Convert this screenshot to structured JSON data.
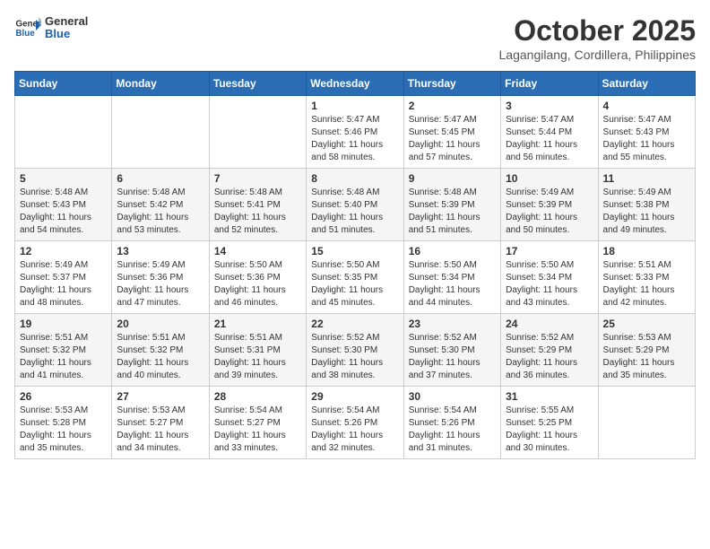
{
  "header": {
    "logo_line1": "General",
    "logo_line2": "Blue",
    "month_year": "October 2025",
    "location": "Lagangilang, Cordillera, Philippines"
  },
  "days_of_week": [
    "Sunday",
    "Monday",
    "Tuesday",
    "Wednesday",
    "Thursday",
    "Friday",
    "Saturday"
  ],
  "weeks": [
    [
      {
        "day": "",
        "content": ""
      },
      {
        "day": "",
        "content": ""
      },
      {
        "day": "",
        "content": ""
      },
      {
        "day": "1",
        "content": "Sunrise: 5:47 AM\nSunset: 5:46 PM\nDaylight: 11 hours and 58 minutes."
      },
      {
        "day": "2",
        "content": "Sunrise: 5:47 AM\nSunset: 5:45 PM\nDaylight: 11 hours and 57 minutes."
      },
      {
        "day": "3",
        "content": "Sunrise: 5:47 AM\nSunset: 5:44 PM\nDaylight: 11 hours and 56 minutes."
      },
      {
        "day": "4",
        "content": "Sunrise: 5:47 AM\nSunset: 5:43 PM\nDaylight: 11 hours and 55 minutes."
      }
    ],
    [
      {
        "day": "5",
        "content": "Sunrise: 5:48 AM\nSunset: 5:43 PM\nDaylight: 11 hours and 54 minutes."
      },
      {
        "day": "6",
        "content": "Sunrise: 5:48 AM\nSunset: 5:42 PM\nDaylight: 11 hours and 53 minutes."
      },
      {
        "day": "7",
        "content": "Sunrise: 5:48 AM\nSunset: 5:41 PM\nDaylight: 11 hours and 52 minutes."
      },
      {
        "day": "8",
        "content": "Sunrise: 5:48 AM\nSunset: 5:40 PM\nDaylight: 11 hours and 51 minutes."
      },
      {
        "day": "9",
        "content": "Sunrise: 5:48 AM\nSunset: 5:39 PM\nDaylight: 11 hours and 51 minutes."
      },
      {
        "day": "10",
        "content": "Sunrise: 5:49 AM\nSunset: 5:39 PM\nDaylight: 11 hours and 50 minutes."
      },
      {
        "day": "11",
        "content": "Sunrise: 5:49 AM\nSunset: 5:38 PM\nDaylight: 11 hours and 49 minutes."
      }
    ],
    [
      {
        "day": "12",
        "content": "Sunrise: 5:49 AM\nSunset: 5:37 PM\nDaylight: 11 hours and 48 minutes."
      },
      {
        "day": "13",
        "content": "Sunrise: 5:49 AM\nSunset: 5:36 PM\nDaylight: 11 hours and 47 minutes."
      },
      {
        "day": "14",
        "content": "Sunrise: 5:50 AM\nSunset: 5:36 PM\nDaylight: 11 hours and 46 minutes."
      },
      {
        "day": "15",
        "content": "Sunrise: 5:50 AM\nSunset: 5:35 PM\nDaylight: 11 hours and 45 minutes."
      },
      {
        "day": "16",
        "content": "Sunrise: 5:50 AM\nSunset: 5:34 PM\nDaylight: 11 hours and 44 minutes."
      },
      {
        "day": "17",
        "content": "Sunrise: 5:50 AM\nSunset: 5:34 PM\nDaylight: 11 hours and 43 minutes."
      },
      {
        "day": "18",
        "content": "Sunrise: 5:51 AM\nSunset: 5:33 PM\nDaylight: 11 hours and 42 minutes."
      }
    ],
    [
      {
        "day": "19",
        "content": "Sunrise: 5:51 AM\nSunset: 5:32 PM\nDaylight: 11 hours and 41 minutes."
      },
      {
        "day": "20",
        "content": "Sunrise: 5:51 AM\nSunset: 5:32 PM\nDaylight: 11 hours and 40 minutes."
      },
      {
        "day": "21",
        "content": "Sunrise: 5:51 AM\nSunset: 5:31 PM\nDaylight: 11 hours and 39 minutes."
      },
      {
        "day": "22",
        "content": "Sunrise: 5:52 AM\nSunset: 5:30 PM\nDaylight: 11 hours and 38 minutes."
      },
      {
        "day": "23",
        "content": "Sunrise: 5:52 AM\nSunset: 5:30 PM\nDaylight: 11 hours and 37 minutes."
      },
      {
        "day": "24",
        "content": "Sunrise: 5:52 AM\nSunset: 5:29 PM\nDaylight: 11 hours and 36 minutes."
      },
      {
        "day": "25",
        "content": "Sunrise: 5:53 AM\nSunset: 5:29 PM\nDaylight: 11 hours and 35 minutes."
      }
    ],
    [
      {
        "day": "26",
        "content": "Sunrise: 5:53 AM\nSunset: 5:28 PM\nDaylight: 11 hours and 35 minutes."
      },
      {
        "day": "27",
        "content": "Sunrise: 5:53 AM\nSunset: 5:27 PM\nDaylight: 11 hours and 34 minutes."
      },
      {
        "day": "28",
        "content": "Sunrise: 5:54 AM\nSunset: 5:27 PM\nDaylight: 11 hours and 33 minutes."
      },
      {
        "day": "29",
        "content": "Sunrise: 5:54 AM\nSunset: 5:26 PM\nDaylight: 11 hours and 32 minutes."
      },
      {
        "day": "30",
        "content": "Sunrise: 5:54 AM\nSunset: 5:26 PM\nDaylight: 11 hours and 31 minutes."
      },
      {
        "day": "31",
        "content": "Sunrise: 5:55 AM\nSunset: 5:25 PM\nDaylight: 11 hours and 30 minutes."
      },
      {
        "day": "",
        "content": ""
      }
    ]
  ]
}
